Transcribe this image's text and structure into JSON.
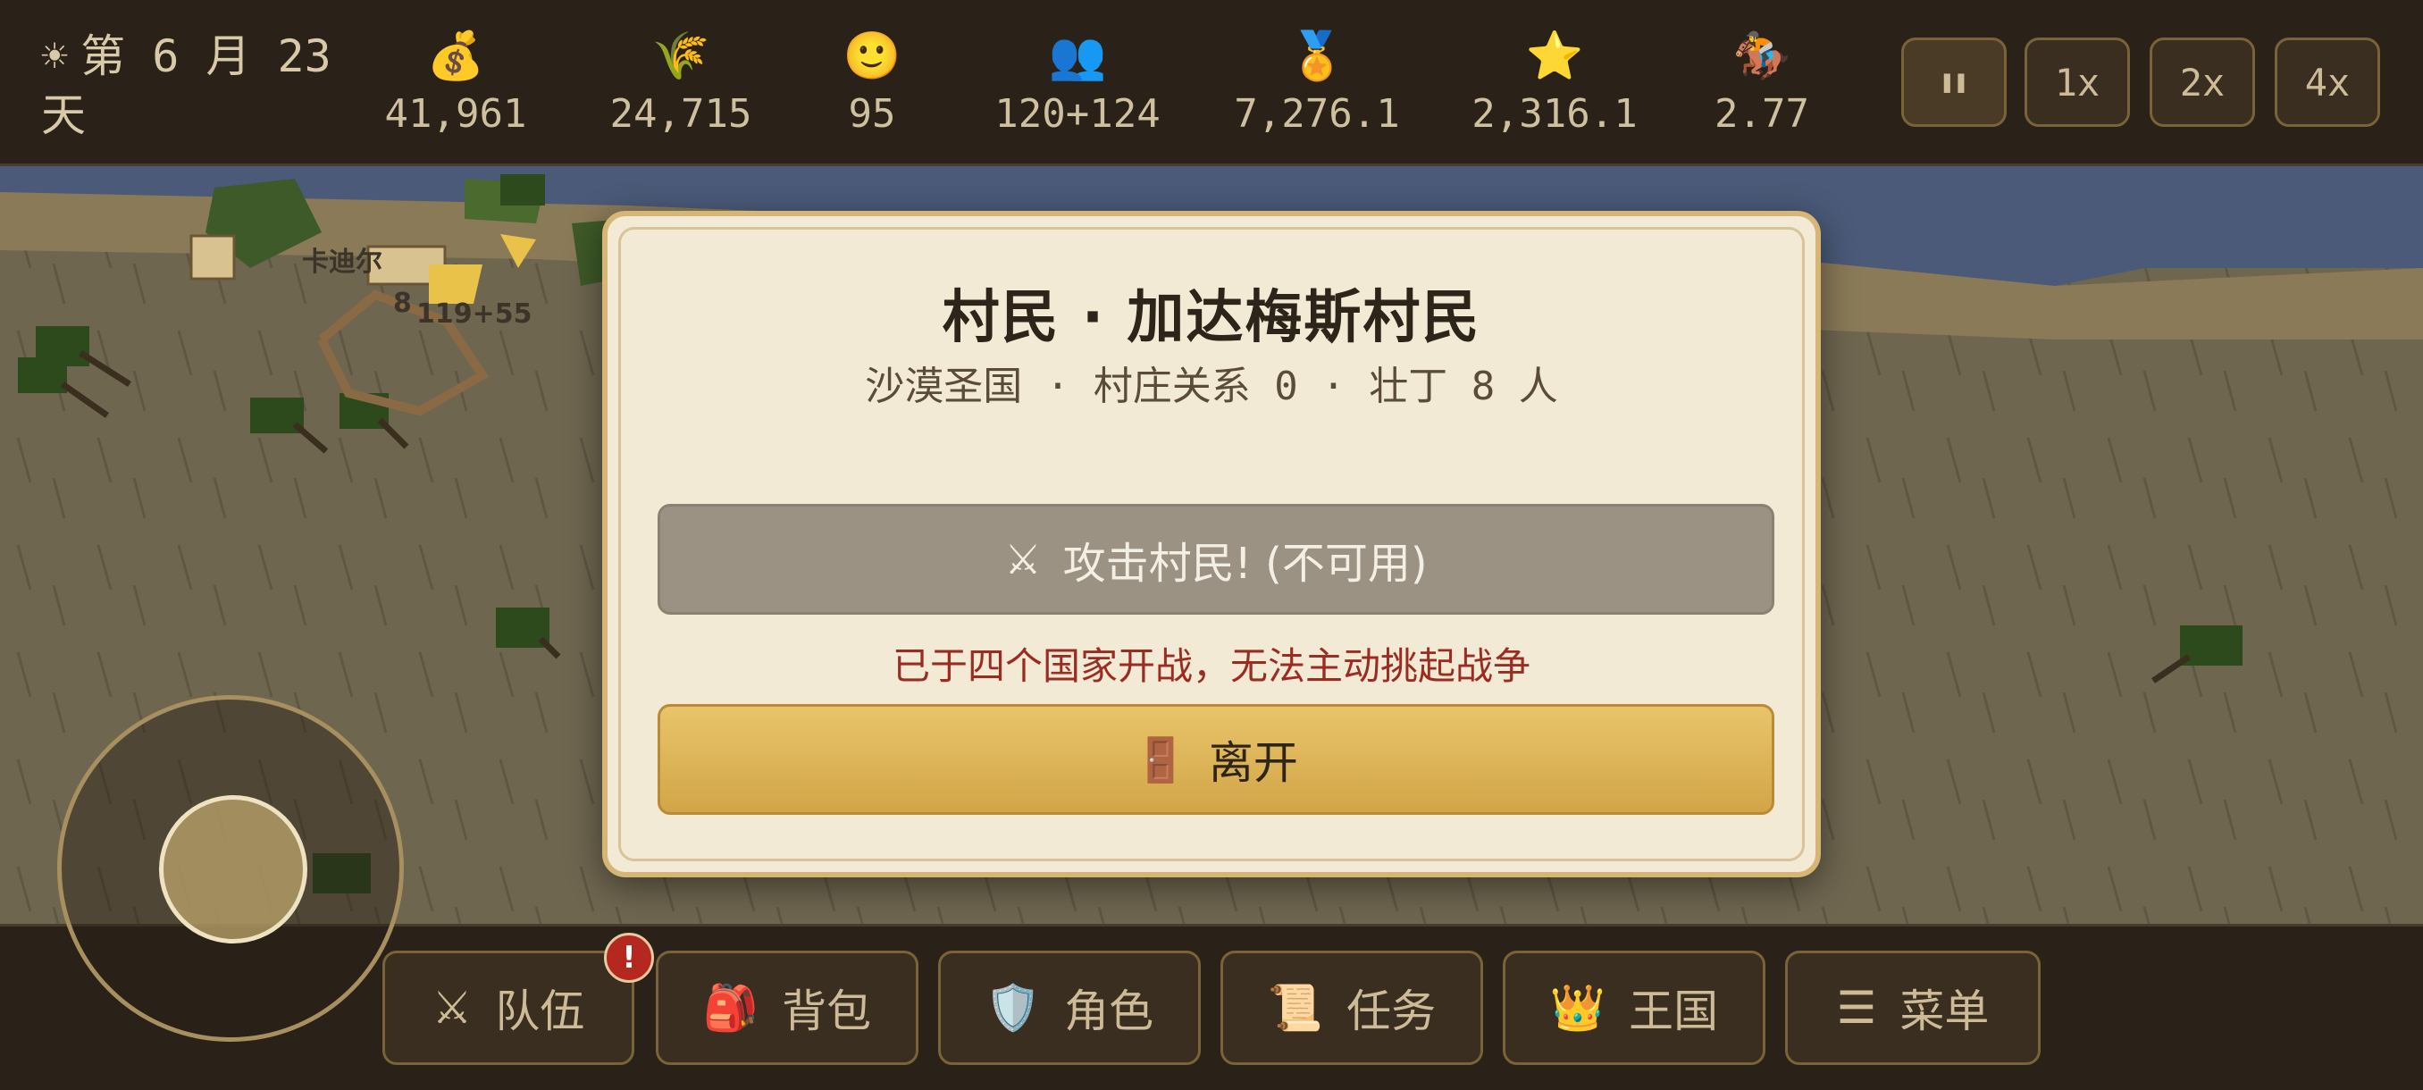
{
  "topbar": {
    "day": {
      "icon": "☀",
      "text": "第 6 月 23 天"
    },
    "stats": [
      {
        "icon": "💰",
        "icon_name": "money-bag-icon",
        "value": "41,961"
      },
      {
        "icon": "🌾",
        "icon_name": "grain-icon",
        "value": "24,715"
      },
      {
        "icon": "🙂",
        "icon_name": "happiness-icon",
        "value": "95"
      },
      {
        "icon": "👥",
        "icon_name": "population-icon",
        "value": "120+124"
      },
      {
        "icon": "🏅",
        "icon_name": "medal-icon",
        "value": "7,276.1"
      },
      {
        "icon": "⭐",
        "icon_name": "star-icon",
        "value": "2,316.1"
      },
      {
        "icon": "🏇",
        "icon_name": "horse-rider-icon",
        "value": "2.77"
      }
    ],
    "speed": [
      {
        "label": "❚❚",
        "name": "pause"
      },
      {
        "label": "1x",
        "name": "1x"
      },
      {
        "label": "2x",
        "name": "2x"
      },
      {
        "label": "4x",
        "name": "4x"
      }
    ]
  },
  "map": {
    "village_label": "卡迪尔",
    "unit_count": "8",
    "army_size": "119+55"
  },
  "dialog": {
    "title": "村民 · 加达梅斯村民",
    "subtitle": "沙漠圣国 · 村庄关系 0 · 壮丁 8 人",
    "attack_icon": "⚔",
    "attack_label": "攻击村民! (不可用)",
    "warning": "已于四个国家开战，无法主动挑起战争",
    "leave_icon": "🚪",
    "leave_label": "离开"
  },
  "bottombar": {
    "badge": "!",
    "buttons": [
      {
        "icon": "⚔",
        "icon_name": "swords-icon",
        "label": "队伍"
      },
      {
        "icon": "🎒",
        "icon_name": "backpack-icon",
        "label": "背包"
      },
      {
        "icon": "🛡️",
        "icon_name": "shield-icon",
        "label": "角色"
      },
      {
        "icon": "📜",
        "icon_name": "scroll-icon",
        "label": "任务"
      },
      {
        "icon": "👑",
        "icon_name": "crown-icon",
        "label": "王国"
      },
      {
        "icon": "☰",
        "icon_name": "menu-icon",
        "label": "菜单"
      }
    ]
  },
  "colors": {
    "bar_bg": "#2a2219",
    "dialog_bg": "#f3ead6",
    "gold_button": "#d9b259",
    "disabled_button": "#9b9283",
    "warning_text": "#9a2c22",
    "water": "#4a5a78",
    "sand": "#8a7a58"
  }
}
